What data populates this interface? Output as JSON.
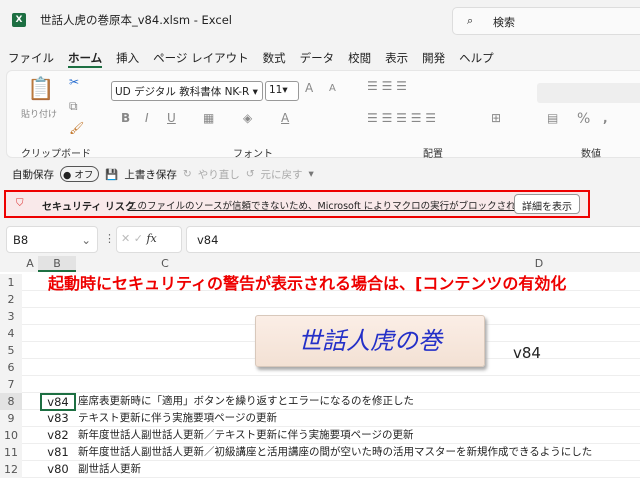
{
  "window": {
    "title": "世話人虎の巻原本_v84.xlsm  -  Excel",
    "search_placeholder": "検索",
    "app_icon": "X"
  },
  "tabs": [
    "ファイル",
    "ホーム",
    "挿入",
    "ページ レイアウト",
    "数式",
    "データ",
    "校閲",
    "表示",
    "開発",
    "ヘルプ"
  ],
  "active_tab": "ホーム",
  "ribbon": {
    "paste": "貼り付け",
    "clipboard": "クリップボード",
    "font_name": "UD デジタル 教科書体 NK-R",
    "font_size": "11",
    "font": "フォント",
    "alignment": "配置",
    "number": "数値",
    "bold": "B",
    "italic": "I",
    "underline": "U",
    "percent": "%"
  },
  "quick_access": {
    "autosave": "自動保存",
    "autosave_state": "オフ",
    "save": "上書き保存",
    "redo": "やり直し",
    "undo": "元に戻す"
  },
  "security": {
    "label": "セキュリティ リスク",
    "message": "このファイルのソースが信頼できないため、Microsoft によりマクロの実行がブロックされました。",
    "button": "詳細を表示",
    "color": "#e00000"
  },
  "formula_bar": {
    "name_box": "B8",
    "fx": "fx",
    "value": "v84"
  },
  "columns": [
    "A",
    "B",
    "C",
    "D"
  ],
  "rows": [
    "1",
    "2",
    "3",
    "4",
    "5",
    "6",
    "7",
    "8",
    "9",
    "10",
    "11",
    "12"
  ],
  "sheet": {
    "banner": "起動時にセキュリティの警告が表示される場合は、[コンテンツの有効化",
    "logo": "世話人虎の巻",
    "version": "v84",
    "history": [
      {
        "v": "v84",
        "text": "座席表更新時に「適用」ボタンを繰り返すとエラーになるのを修正した"
      },
      {
        "v": "v83",
        "text": "テキスト更新に伴う実施要項ページの更新"
      },
      {
        "v": "v82",
        "text": "新年度世話人副世話人更新／テキスト更新に伴う実施要項ページの更新"
      },
      {
        "v": "v81",
        "text": "新年度世話人副世話人更新／初級講座と活用講座の間が空いた時の活用マスターを新規作成できるようにした"
      },
      {
        "v": "v80",
        "text": "副世話人更新"
      }
    ]
  }
}
